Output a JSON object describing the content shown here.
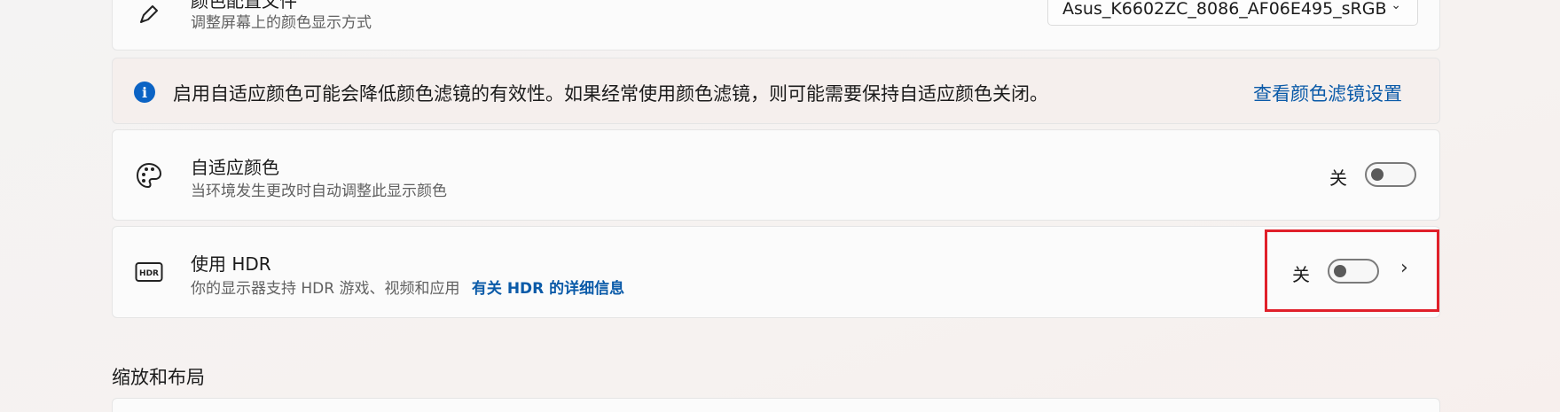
{
  "color_profile": {
    "title": "颜色配置文件",
    "subtitle": "调整屏幕上的颜色显示方式",
    "dropdown_value": "Asus_K6602ZC_8086_AF06E495_sRGB",
    "icon": "pen-icon"
  },
  "info_bar": {
    "text": "启用自适应颜色可能会降低颜色滤镜的有效性。如果经常使用颜色滤镜，则可能需要保持自适应颜色关闭。",
    "link": "查看颜色滤镜设置",
    "icon": "info-icon"
  },
  "adaptive_color": {
    "title": "自适应颜色",
    "subtitle": "当环境发生更改时自动调整此显示颜色",
    "state_label": "关",
    "icon": "palette-icon"
  },
  "hdr": {
    "title": "使用 HDR",
    "subtitle": "你的显示器支持 HDR 游戏、视频和应用",
    "link": "有关 HDR 的详细信息",
    "state_label": "关",
    "icon": "hdr-icon"
  },
  "section": {
    "title": "缩放和布局"
  },
  "colors": {
    "accent": "#0a5aa8",
    "highlight": "#e0202a"
  }
}
